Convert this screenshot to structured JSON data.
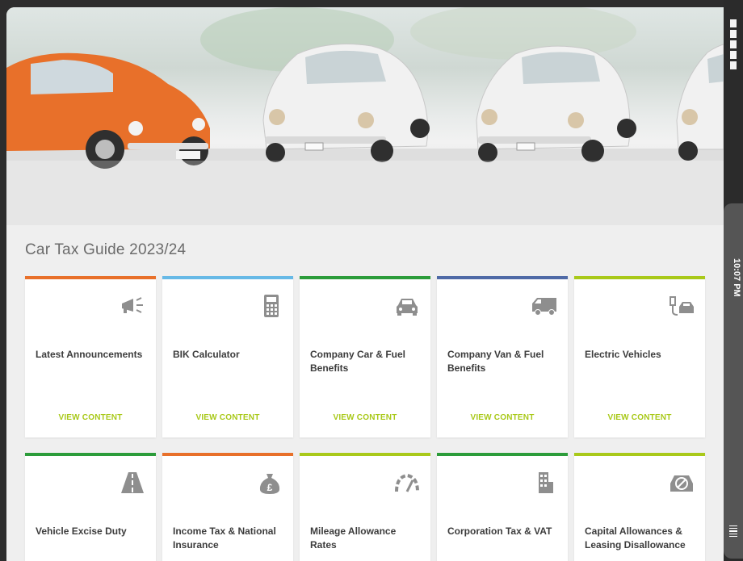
{
  "status": {
    "time": "10:07 PM"
  },
  "page": {
    "title": "Car Tax Guide 2023/24"
  },
  "colors": {
    "cta": "#a9c91a",
    "orange": "#e8702a",
    "blue": "#67b9e6",
    "green": "#2c9c3a",
    "navy": "#4f6aa6",
    "lime": "#a9c91a"
  },
  "cards": [
    {
      "label": "Latest Announcements",
      "cta": "VIEW CONTENT",
      "icon": "megaphone-icon",
      "accent": "#e8702a"
    },
    {
      "label": "BIK Calculator",
      "cta": "VIEW CONTENT",
      "icon": "calculator-icon",
      "accent": "#67b9e6"
    },
    {
      "label": "Company Car & Fuel Benefits",
      "cta": "VIEW CONTENT",
      "icon": "car-icon",
      "accent": "#2c9c3a"
    },
    {
      "label": "Company Van & Fuel Benefits",
      "cta": "VIEW CONTENT",
      "icon": "van-icon",
      "accent": "#4f6aa6"
    },
    {
      "label": "Electric Vehicles",
      "cta": "VIEW CONTENT",
      "icon": "ev-charging-icon",
      "accent": "#a9c91a"
    },
    {
      "label": "Vehicle Excise Duty",
      "icon": "road-icon",
      "accent": "#2c9c3a"
    },
    {
      "label": "Income Tax & National Insurance",
      "icon": "money-bag-icon",
      "accent": "#e8702a"
    },
    {
      "label": "Mileage Allowance Rates",
      "icon": "speedometer-icon",
      "accent": "#a9c91a"
    },
    {
      "label": "Corporation Tax & VAT",
      "icon": "building-icon",
      "accent": "#2c9c3a"
    },
    {
      "label": "Capital Allowances & Leasing Disallowance",
      "icon": "disallowed-car-icon",
      "accent": "#a9c91a"
    }
  ]
}
